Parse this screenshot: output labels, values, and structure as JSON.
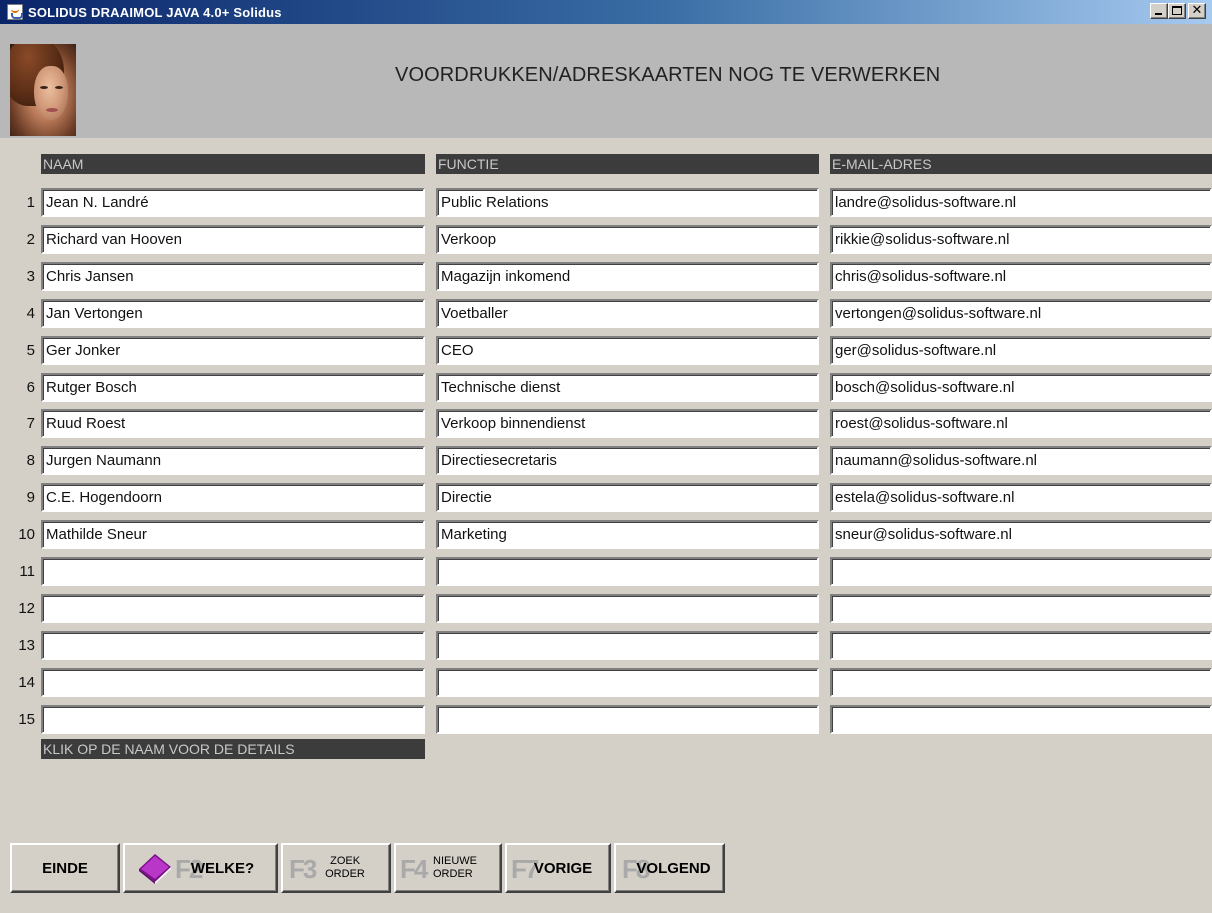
{
  "window": {
    "title": "SOLIDUS DRAAIMOL JAVA 4.0+ Solidus"
  },
  "header": {
    "title": "VOORDRUKKEN/ADRESKAARTEN NOG TE VERWERKEN"
  },
  "columns": {
    "name": "NAAM",
    "function": "FUNCTIE",
    "email": "E-MAIL-ADRES"
  },
  "rows": [
    {
      "num": "1",
      "name": "Jean N. Landré",
      "function": "Public Relations",
      "email": "landre@solidus-software.nl"
    },
    {
      "num": "2",
      "name": "Richard van Hooven",
      "function": "Verkoop",
      "email": "rikkie@solidus-software.nl"
    },
    {
      "num": "3",
      "name": "Chris Jansen",
      "function": "Magazijn inkomend",
      "email": "chris@solidus-software.nl"
    },
    {
      "num": "4",
      "name": "Jan Vertongen",
      "function": "Voetballer",
      "email": "vertongen@solidus-software.nl"
    },
    {
      "num": "5",
      "name": "Ger Jonker",
      "function": "CEO",
      "email": "ger@solidus-software.nl"
    },
    {
      "num": "6",
      "name": "Rutger Bosch",
      "function": "Technische dienst",
      "email": "bosch@solidus-software.nl"
    },
    {
      "num": "7",
      "name": "Ruud Roest",
      "function": "Verkoop binnendienst",
      "email": "roest@solidus-software.nl"
    },
    {
      "num": "8",
      "name": "Jurgen Naumann",
      "function": "Directiesecretaris",
      "email": "naumann@solidus-software.nl"
    },
    {
      "num": "9",
      "name": "C.E. Hogendoorn",
      "function": "Directie",
      "email": "estela@solidus-software.nl"
    },
    {
      "num": "10",
      "name": "Mathilde Sneur",
      "function": "Marketing",
      "email": "sneur@solidus-software.nl"
    },
    {
      "num": "11",
      "name": "",
      "function": "",
      "email": ""
    },
    {
      "num": "12",
      "name": "",
      "function": "",
      "email": ""
    },
    {
      "num": "13",
      "name": "",
      "function": "",
      "email": ""
    },
    {
      "num": "14",
      "name": "",
      "function": "",
      "email": ""
    },
    {
      "num": "15",
      "name": "",
      "function": "",
      "email": ""
    }
  ],
  "footnote": "KLIK OP DE NAAM VOOR DE DETAILS",
  "buttons": {
    "einde": "EINDE",
    "welke": {
      "key": "F2",
      "label": "WELKE?",
      "icon": "book-icon",
      "icon_color": "#9b1fa8"
    },
    "zoek": {
      "key": "F3",
      "line1": "ZOEK",
      "line2": "ORDER"
    },
    "nieuwe": {
      "key": "F4",
      "line1": "NIEUWE",
      "line2": "ORDER"
    },
    "vorige": {
      "key": "F7",
      "label": "VORIGE"
    },
    "volgend": {
      "key": "F8",
      "label": "VOLGEND"
    }
  },
  "colors": {
    "background": "#d4d0c8",
    "header_band": "#b8b8b8",
    "column_header": "#3c3c3c",
    "title_bar": "#0a246a"
  }
}
